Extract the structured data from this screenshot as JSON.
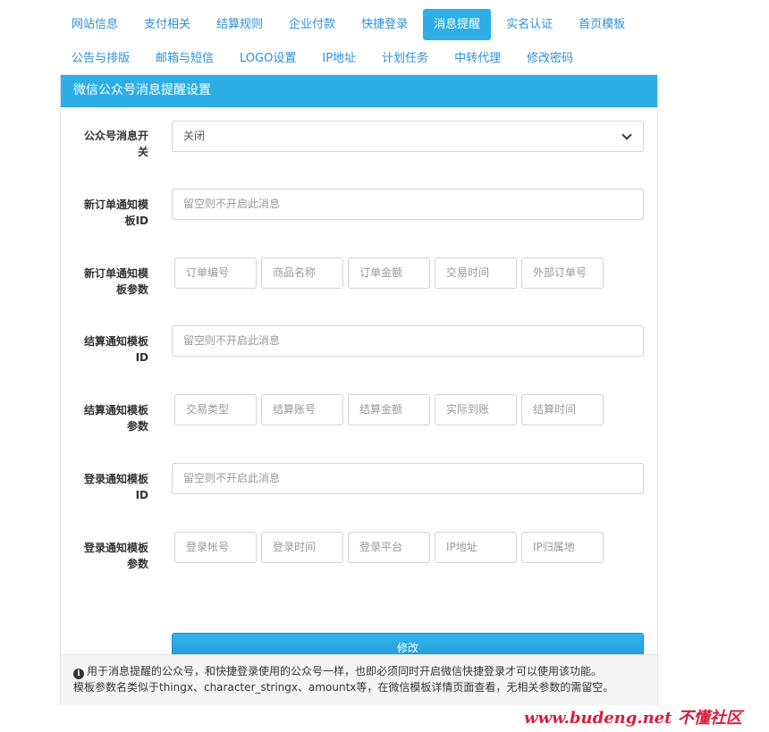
{
  "nav": {
    "row1": [
      "网站信息",
      "支付相关",
      "结算规则",
      "企业付款",
      "快捷登录",
      "消息提醒",
      "实名认证",
      "首页模板"
    ],
    "row2": [
      "公告与排版",
      "邮箱与短信",
      "LOGO设置",
      "IP地址",
      "计划任务",
      "中转代理",
      "修改密码"
    ],
    "active": "消息提醒"
  },
  "panel": {
    "title": "微信公众号消息提醒设置"
  },
  "form": {
    "switch": {
      "label_line1": "公众号消息开",
      "label_line2": "关",
      "value": "关闭"
    },
    "order_tpl_id": {
      "label_line1": "新订单通知模",
      "label_line2": "板ID",
      "placeholder": "留空则不开启此消息"
    },
    "order_tpl_params": {
      "label_line1": "新订单通知模",
      "label_line2": "板参数",
      "params": [
        "订单编号",
        "商品名称",
        "订单金额",
        "交易时间",
        "外部订单号"
      ]
    },
    "settle_tpl_id": {
      "label_line1": "结算通知模板",
      "label_line2": "ID",
      "placeholder": "留空则不开启此消息"
    },
    "settle_tpl_params": {
      "label_line1": "结算通知模板",
      "label_line2": "参数",
      "params": [
        "交易类型",
        "结算账号",
        "结算金额",
        "实际到账",
        "结算时间"
      ]
    },
    "login_tpl_id": {
      "label_line1": "登录通知模板",
      "label_line2": "ID",
      "placeholder": "留空则不开启此消息"
    },
    "login_tpl_params": {
      "label_line1": "登录通知模板",
      "label_line2": "参数",
      "params": [
        "登录帐号",
        "登录时间",
        "登录平台",
        "IP地址",
        "IP归属地"
      ]
    },
    "submit_label": "修改"
  },
  "footer": {
    "line1": "用于消息提醒的公众号，和快捷登录使用的公众号一样，也即必须同时开启微信快捷登录才可以使用该功能。",
    "line2": "模板参数名类似于thingx、character_stringx、amountx等，在微信模板详情页面查看，无相关参数的需留空。"
  },
  "watermark": "www.budeng.net 不懂社区"
}
